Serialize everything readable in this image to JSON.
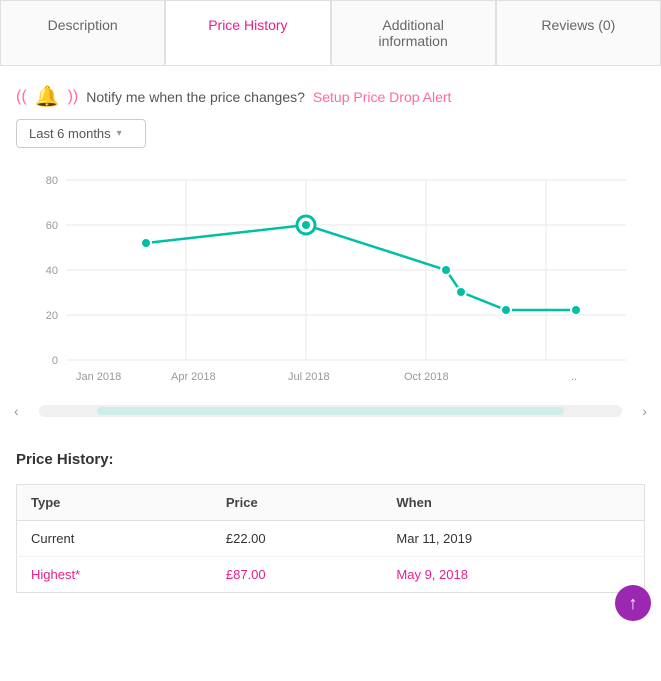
{
  "tabs": [
    {
      "id": "description",
      "label": "Description",
      "active": false
    },
    {
      "id": "price-history",
      "label": "Price History",
      "active": true
    },
    {
      "id": "additional-info",
      "label": "Additional information",
      "active": false
    },
    {
      "id": "reviews",
      "label": "Reviews (0)",
      "active": false
    }
  ],
  "notify": {
    "text": "Notify me when the price changes?",
    "link_text": "Setup Price Drop Alert"
  },
  "dropdown": {
    "label": "Last 6 months"
  },
  "chart": {
    "x_labels": [
      "Jan 2018",
      "Apr 2018",
      "Jul 2018",
      "Oct 2018",
      ".."
    ],
    "y_labels": [
      "0",
      "20",
      "40",
      "60",
      "80"
    ],
    "color": "#00bfa5",
    "points": [
      {
        "x": 0.13,
        "y": 0.37,
        "large": false
      },
      {
        "x": 0.44,
        "y": 0.27,
        "large": true
      },
      {
        "x": 0.72,
        "y": 0.52,
        "large": false
      },
      {
        "x": 0.78,
        "y": 0.57,
        "large": false
      },
      {
        "x": 0.9,
        "y": 0.59,
        "large": false
      },
      {
        "x": 0.97,
        "y": 0.59,
        "large": false
      }
    ]
  },
  "price_history": {
    "title": "Price History:",
    "columns": [
      "Type",
      "Price",
      "When"
    ],
    "rows": [
      {
        "type": "Current",
        "price": "£22.00",
        "when": "Mar 11, 2019",
        "highlight": false
      },
      {
        "type": "Highest*",
        "price": "£87.00",
        "when": "May 9, 2018",
        "highlight": true
      }
    ]
  },
  "scroll_top": "↑"
}
